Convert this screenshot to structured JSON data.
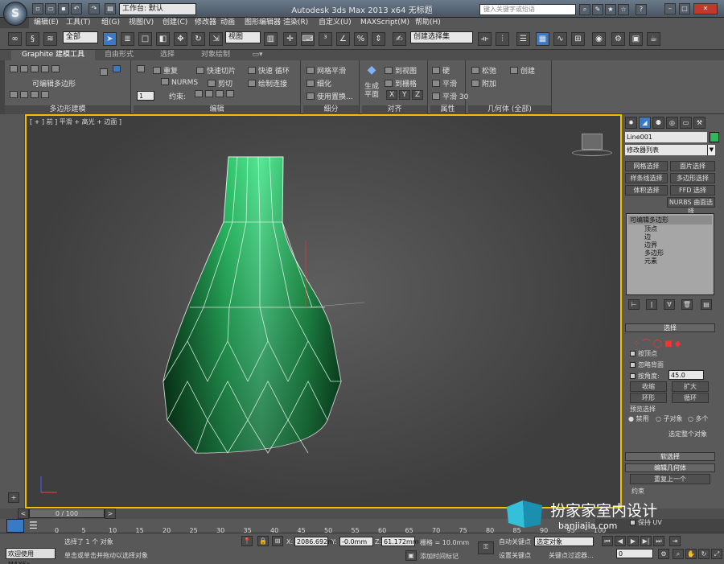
{
  "titlebar": {
    "app_title": "Autodesk 3ds Max  2013 x64    无标题",
    "workspace": "工作台: 默认",
    "search_placeholder": "键入关键字或短语"
  },
  "logo_glyph": "S",
  "menu": [
    "编辑(E)",
    "工具(T)",
    "组(G)",
    "视图(V)",
    "创建(C)",
    "修改器",
    "动画",
    "图形编辑器",
    "渲染(R)",
    "自定义(U)",
    "MAXScript(M)",
    "帮助(H)"
  ],
  "toolbar": {
    "filter": "全部",
    "refsys": "视图",
    "selection_set": "创建选择集"
  },
  "ribbon": {
    "tabs": [
      "Graphite 建模工具",
      "自由形式",
      "选择",
      "对象绘制"
    ],
    "groups": {
      "polymodel": "多边形建模",
      "edit": "编辑",
      "subdivide": "细分",
      "align": "对齐",
      "properties": "属性",
      "geometry": "几何体 (全部)"
    },
    "edit_poly": "可编辑多边形",
    "items": {
      "repeat": "重复",
      "quickslice": "快速切片",
      "quickloop": "快速 循环",
      "nurms": "NURMS",
      "cut": "剪切",
      "paintconnect": "绘制连接",
      "constraint": "约束:",
      "meshsmooth": "网格平滑",
      "tessellate": "细化",
      "usedisp": "使用置换...",
      "genplane": "生成\n平面",
      "toview": "到视图",
      "togrid": "到栅格",
      "x": "X",
      "y": "Y",
      "z": "Z",
      "hard": "硬",
      "smooth": "平滑",
      "smooth30": "平滑 30",
      "relax": "松弛",
      "create": "创建",
      "attach": "附加",
      "spinner": "1"
    }
  },
  "viewport": {
    "label": "[ + ] 前 ] 平滑 + 高光 + 边面 ]"
  },
  "command_panel": {
    "obj_name": "Line001",
    "obj_color": "#2fb85c",
    "modifier_list": "修改器列表",
    "buttons": [
      "网格选择",
      "面片选择",
      "样条线选择",
      "多边形选择",
      "体积选择",
      "FFD 选择",
      "NURBS 曲面选择"
    ],
    "stack": [
      "可编辑多边形",
      "顶点",
      "边",
      "边界",
      "多边形",
      "元素"
    ],
    "rollout_select": "选择",
    "by_vertex": "按顶点",
    "ignore_back": "忽略背面",
    "by_angle": "按角度:",
    "angle": "45.0",
    "shrink": "收缩",
    "grow": "扩大",
    "ring": "环形",
    "loop": "循环",
    "preview": "预览选择",
    "disable": "禁用",
    "subobj": "子对象",
    "multi": "多个",
    "select_whole": "选定整个对象",
    "soft_sel": "软选择",
    "edit_geo": "编辑几何体",
    "repeat_last": "重复上一个",
    "constraint": "约束",
    "preserve_uv": "保持 UV"
  },
  "timeline": {
    "slider": "0 / 100",
    "ticks": [
      "0",
      "5",
      "10",
      "15",
      "20",
      "25",
      "30",
      "35",
      "40",
      "45",
      "50",
      "55",
      "60",
      "65",
      "70",
      "75",
      "80",
      "85",
      "90",
      "95",
      "100"
    ]
  },
  "status": {
    "selected": "选择了 1 个 对象",
    "hint": "单击或单击并拖动以选择对象",
    "welcome": "欢迎使用 MAXSc",
    "x_label": "X:",
    "x": "2086.692m",
    "y_label": "Y:",
    "y": "-0.0mm",
    "z_label": "Z:",
    "z": "61.172mm",
    "grid": "栅格 = 10.0mm",
    "add_time_tag": "添加时间标记",
    "auto_key": "自动关键点",
    "set_key": "设置关键点",
    "key_obj": "选定对象",
    "key_filter": "关键点过滤器...",
    "frame": "0"
  },
  "watermark": {
    "title": "扮家家室内设计",
    "url": "banjiajia.com"
  }
}
